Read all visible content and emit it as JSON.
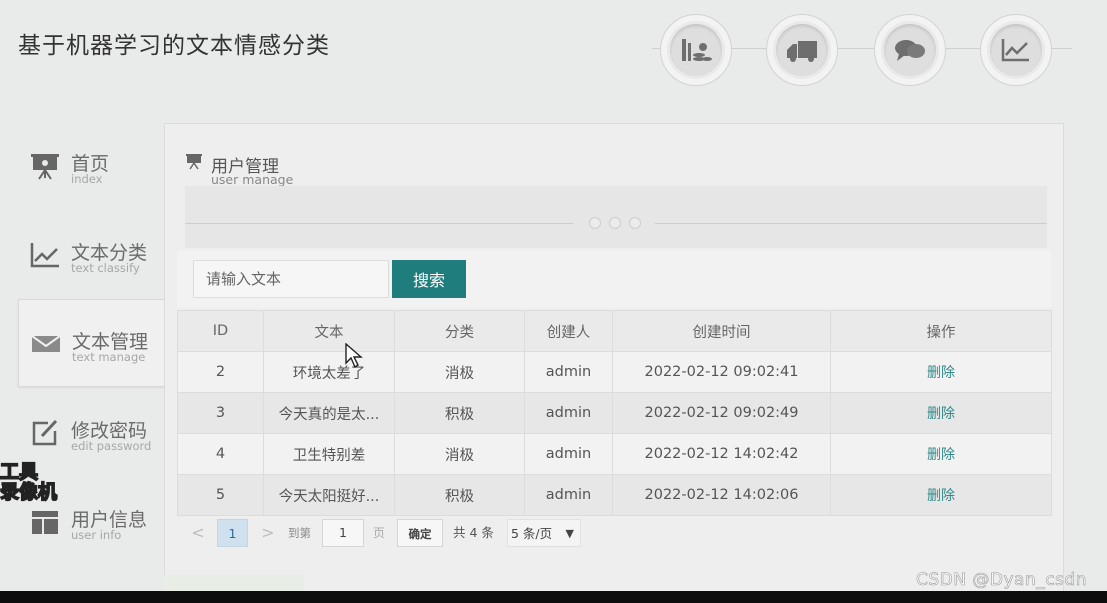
{
  "app": {
    "title": "基于机器学习的文本情感分类"
  },
  "top_icons": [
    "books-coins-icon",
    "truck-icon",
    "chat-bubbles-icon",
    "line-chart-icon"
  ],
  "sidebar": {
    "items": [
      {
        "label": "首页",
        "sub": "index",
        "icon": "presentation-board-icon"
      },
      {
        "label": "文本分类",
        "sub": "text classify",
        "icon": "line-chart-icon"
      },
      {
        "label": "文本管理",
        "sub": "text manage",
        "icon": "envelope-icon",
        "active": true
      },
      {
        "label": "修改密码",
        "sub": "edit password",
        "icon": "edit-icon"
      },
      {
        "label": "用户信息",
        "sub": "user info",
        "icon": "layout-icon"
      }
    ]
  },
  "panel": {
    "title": "用户管理",
    "subtitle": "user manage"
  },
  "search": {
    "placeholder": "请输入文本",
    "button": "搜索"
  },
  "table": {
    "columns": [
      "ID",
      "文本",
      "分类",
      "创建人",
      "创建时间",
      "操作"
    ],
    "rows": [
      {
        "id": "2",
        "text": "环境太差了",
        "category": "消极",
        "creator": "admin",
        "time": "2022-02-12 09:02:41",
        "action": "删除"
      },
      {
        "id": "3",
        "text": "今天真的是太...",
        "category": "积极",
        "creator": "admin",
        "time": "2022-02-12 09:02:49",
        "action": "删除"
      },
      {
        "id": "4",
        "text": "卫生特别差",
        "category": "消极",
        "creator": "admin",
        "time": "2022-02-12 14:02:42",
        "action": "删除"
      },
      {
        "id": "5",
        "text": "今天太阳挺好...",
        "category": "积极",
        "creator": "admin",
        "time": "2022-02-12 14:02:06",
        "action": "删除"
      }
    ]
  },
  "pager": {
    "prev": "<",
    "current": "1",
    "next": ">",
    "goto_label": "到第",
    "goto_value": "1",
    "page_label": "页",
    "confirm": "确定",
    "total": "共 4 条",
    "page_size": "5 条/页"
  },
  "overlay": {
    "left_watermark_line1": "工具",
    "left_watermark_line2": "录像机",
    "watermark": "CSDN @Dyan_csdn"
  },
  "colors": {
    "accent": "#1f7d7d",
    "link": "#2f8a8a",
    "active_page": "#cfe0ee"
  }
}
